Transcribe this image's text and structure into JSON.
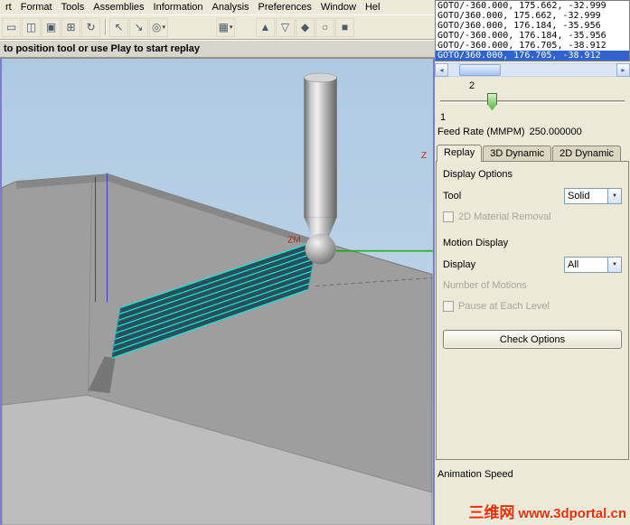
{
  "menu": {
    "items": [
      "rt",
      "Format",
      "Tools",
      "Assemblies",
      "Information",
      "Analysis",
      "Preferences",
      "Window",
      "Hel"
    ]
  },
  "toolbar": {
    "icons": [
      {
        "glyph": "▭"
      },
      {
        "glyph": "◫"
      },
      {
        "glyph": "▣"
      },
      {
        "glyph": "⊞"
      },
      {
        "glyph": "↻"
      },
      {
        "glyph": "↖"
      },
      {
        "glyph": "↘"
      },
      {
        "glyph": "◎"
      },
      {
        "glyph": "▦"
      },
      {
        "glyph": "▲"
      },
      {
        "glyph": "▽"
      },
      {
        "glyph": "◆"
      },
      {
        "glyph": "○"
      },
      {
        "glyph": "■"
      }
    ],
    "dropdown_glyph": "▾"
  },
  "prompt": {
    "text": "to position tool or use Play to start replay"
  },
  "goto": {
    "rows": [
      "GOTO/-360.000, 175.662, -32.999",
      "GOTO/360.000, 175.662, -32.999",
      "GOTO/360.000, 176.184, -35.956",
      "GOTO/-360.000, 176.184, -35.956",
      "GOTO/-360.000, 176.705, -38.912",
      "GOTO/360.000, 176.705, -38.912"
    ],
    "selected_index": 5
  },
  "scrollbar": {
    "left_arrow": "◂",
    "right_arrow": "▸"
  },
  "slider": {
    "value_label": "2",
    "min_label": "1"
  },
  "feed_rate": {
    "label": "Feed Rate (MMPM)",
    "value": "250.000000"
  },
  "tabs": {
    "replay": "Replay",
    "dyn3d": "3D Dynamic",
    "dyn2d": "2D Dynamic"
  },
  "panel": {
    "display_options_heading": "Display Options",
    "tool_label": "Tool",
    "tool_value": "Solid",
    "material_removal_label": "2D Material Removal",
    "motion_display_heading": "Motion Display",
    "display_label": "Display",
    "display_value": "All",
    "number_of_motions_label": "Number of Motions",
    "pause_label": "Pause at Each Level",
    "check_options_label": "Check Options",
    "animation_speed_label": "Animation Speed"
  },
  "viewport": {
    "axis_label_zm": "ZM",
    "axis_label_z": "Z"
  },
  "watermark": {
    "text_cn": "三维网",
    "text_url": "www.3dportal.cn"
  },
  "colors": {
    "selection_blue": "#3163ce",
    "toolpath_cyan": "#19e8e0",
    "axis_green": "#00aa00",
    "watermark_red": "#f32b00",
    "viewport_sky": "#b7d0e6"
  }
}
